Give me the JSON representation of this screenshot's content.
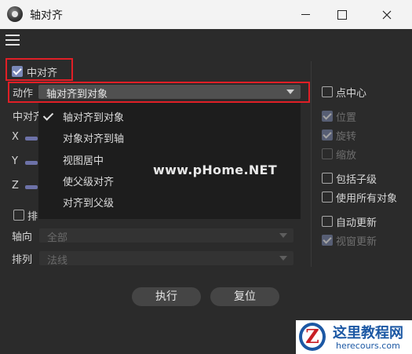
{
  "window": {
    "title": "轴对齐"
  },
  "center_align": {
    "label": "中对齐",
    "checked": true
  },
  "action": {
    "label": "动作",
    "selected": "轴对齐到对象",
    "options": [
      "轴对齐到对象",
      "对象对齐到轴",
      "视图居中",
      "使父级对齐",
      "对齐到父级"
    ]
  },
  "hidden_fragments": {
    "center_partial": "中对齐",
    "row_partial": "排"
  },
  "axes": {
    "x": "X",
    "y": "Y",
    "z": "Z"
  },
  "axis_dir": {
    "label": "轴向",
    "value": "全部"
  },
  "arrange": {
    "label": "排列",
    "value": "法线"
  },
  "right_panel": {
    "point_center": "点中心",
    "position": "位置",
    "rotation": "旋转",
    "scale": "缩放",
    "include_children": "包括子级",
    "use_all_objects": "使用所有对象",
    "auto_update": "自动更新",
    "viewport_update": "视窗更新"
  },
  "buttons": {
    "execute": "执行",
    "reset": "复位"
  },
  "watermark": "www.pHome.NET",
  "logo": {
    "mark": "Z",
    "cn": "这里教程网",
    "en": "herecours.com"
  },
  "colors": {
    "accent": "#7a88b8",
    "highlight": "#e01f26",
    "background": "#2b2b2b",
    "popup": "#1d1d1d"
  }
}
